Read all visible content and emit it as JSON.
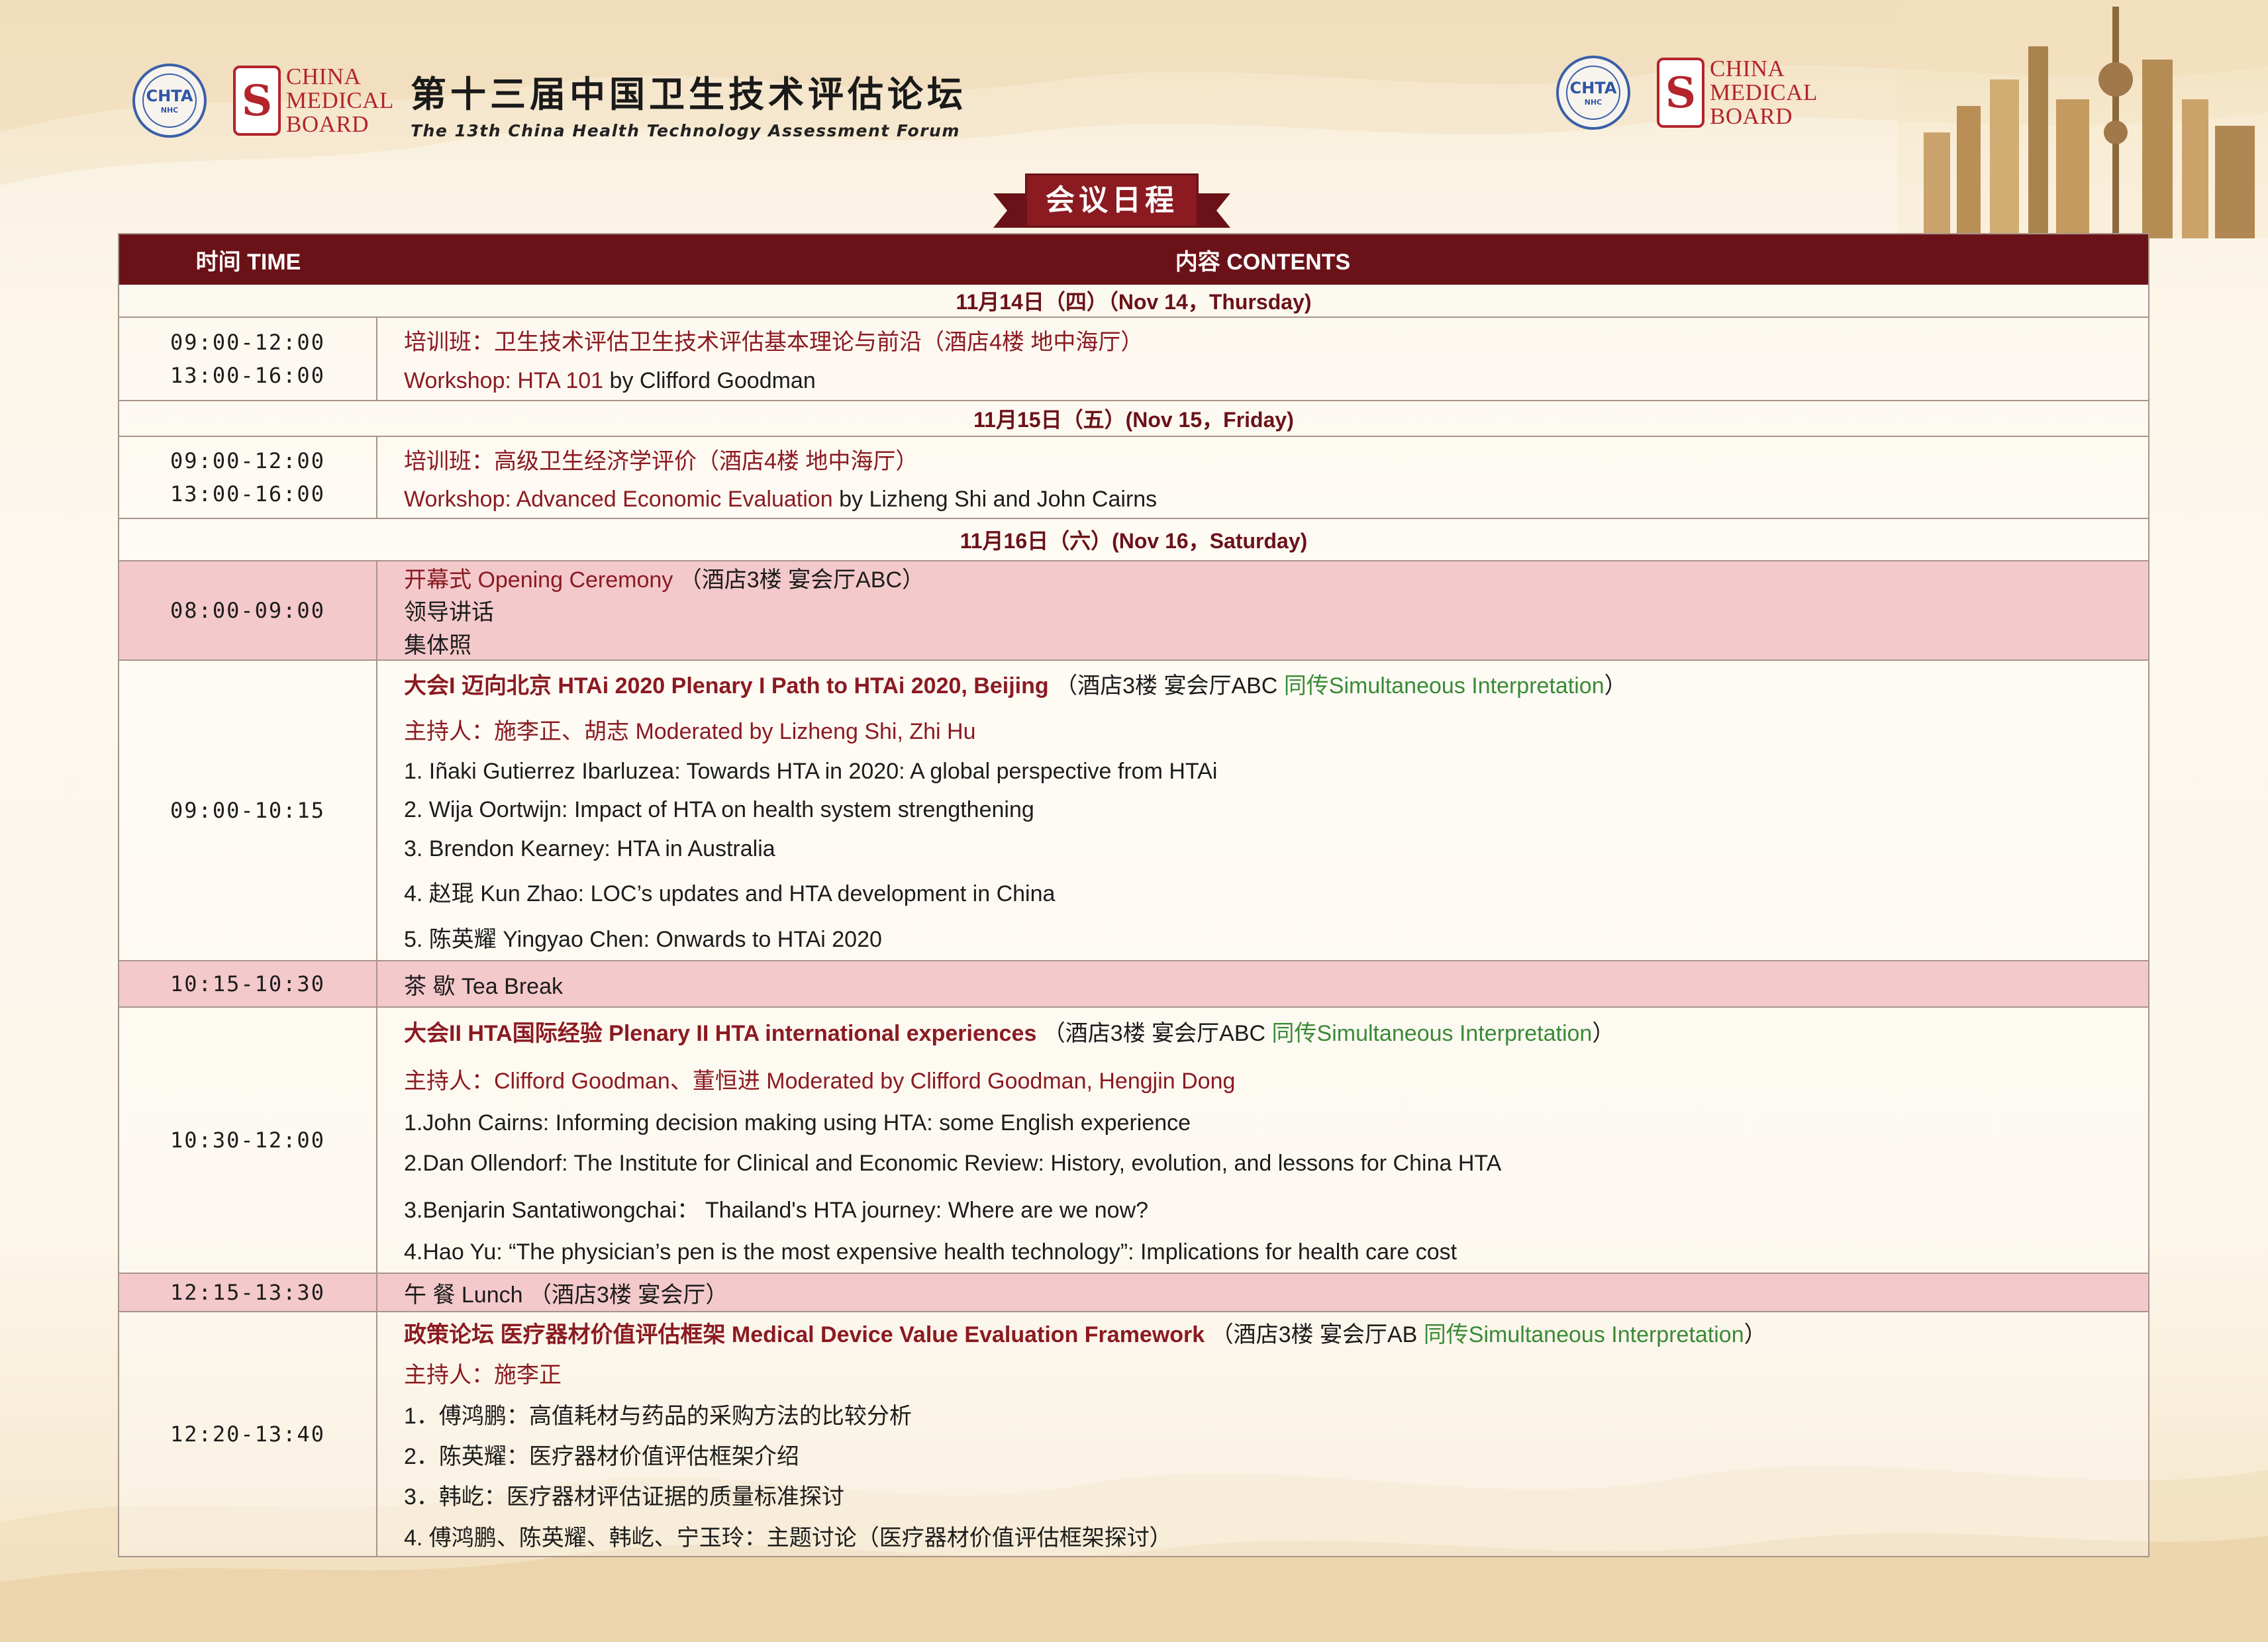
{
  "header": {
    "seal_text": "CHTA",
    "seal_sub": "NHC",
    "cmb_mark": "S",
    "cmb_name": [
      "CHINA",
      "MEDICAL",
      "BOARD"
    ],
    "title_cn": "第十三届中国卫生技术评估论坛",
    "title_en": "The 13th China Health Technology Assessment Forum",
    "colors": {
      "maroon": "#6b1218",
      "red": "#8b1a21",
      "green": "#3a8a36",
      "pink": "#f4c9cc",
      "seal_blue": "#3b5fa8"
    }
  },
  "banner": {
    "label": "会议日程"
  },
  "table": {
    "col_time": "时间  TIME",
    "col_contents": "内容  CONTENTS",
    "days": [
      {
        "label": "11月14日（四）（Nov 14，Thursday)",
        "rows": [
          {
            "times": [
              "09:00-12:00",
              "13:00-16:00"
            ],
            "lines": [
              {
                "parts": [
                  {
                    "t": "培训班：卫生技术评估卫生技术评估基本理论与前沿（酒店4楼  地中海厅）",
                    "s": "red"
                  }
                ]
              },
              {
                "parts": [
                  {
                    "t": "Workshop: HTA 101",
                    "s": "red"
                  },
                  {
                    "t": " by Clifford Goodman",
                    "s": ""
                  }
                ]
              }
            ]
          }
        ]
      },
      {
        "label": "11月15日（五）(Nov 15，Friday)",
        "rows": [
          {
            "times": [
              "09:00-12:00",
              "13:00-16:00"
            ],
            "lines": [
              {
                "parts": [
                  {
                    "t": "培训班：高级卫生经济学评价（酒店4楼  地中海厅）",
                    "s": "red"
                  }
                ]
              },
              {
                "parts": [
                  {
                    "t": "Workshop: Advanced Economic Evaluation",
                    "s": "red"
                  },
                  {
                    "t": " by Lizheng Shi and John Cairns",
                    "s": ""
                  }
                ]
              }
            ]
          }
        ]
      },
      {
        "label": "11月16日（六）(Nov 16，Saturday)",
        "rows": [
          {
            "pink": true,
            "times": [
              "08:00-09:00"
            ],
            "lines": [
              {
                "parts": [
                  {
                    "t": "开幕式  Opening Ceremony",
                    "s": "red"
                  },
                  {
                    "t": "  （酒店3楼  宴会厅ABC）",
                    "s": ""
                  }
                ]
              },
              {
                "parts": [
                  {
                    "t": "领导讲话",
                    "s": ""
                  }
                ]
              },
              {
                "parts": [
                  {
                    "t": "集体照",
                    "s": ""
                  }
                ]
              }
            ]
          },
          {
            "times": [
              "09:00-10:15"
            ],
            "lines": [
              {
                "parts": [
                  {
                    "t": "大会I 迈向北京 HTAi 2020  Plenary I Path to HTAi 2020, Beijing",
                    "s": "boldred"
                  },
                  {
                    "t": "  （酒店3楼  宴会厅ABC ",
                    "s": ""
                  },
                  {
                    "t": "同传Simultaneous Interpretation",
                    "s": "green"
                  },
                  {
                    "t": "）",
                    "s": ""
                  }
                ]
              },
              {
                "parts": [
                  {
                    "t": "主持人：施李正、胡志   Moderated by Lizheng Shi, Zhi Hu",
                    "s": "red"
                  }
                ]
              },
              {
                "parts": [
                  {
                    "t": "1. Iñaki Gutierrez Ibarluzea: Towards HTA in 2020: A global perspective from HTAi",
                    "s": ""
                  }
                ]
              },
              {
                "parts": [
                  {
                    "t": "2. Wija Oortwijn: Impact of HTA on health system strengthening",
                    "s": ""
                  }
                ]
              },
              {
                "parts": [
                  {
                    "t": "3. Brendon Kearney: HTA in Australia",
                    "s": ""
                  }
                ]
              },
              {
                "parts": [
                  {
                    "t": "4. 赵琨  Kun Zhao: LOC’s updates and HTA development in China",
                    "s": ""
                  }
                ]
              },
              {
                "parts": [
                  {
                    "t": "5. 陈英耀  Yingyao Chen: Onwards to HTAi 2020",
                    "s": ""
                  }
                ]
              }
            ]
          },
          {
            "pink": true,
            "times": [
              "10:15-10:30"
            ],
            "lines": [
              {
                "parts": [
                  {
                    "t": "茶  歇    Tea Break",
                    "s": ""
                  }
                ]
              }
            ]
          },
          {
            "times": [
              "10:30-12:00"
            ],
            "lines": [
              {
                "parts": [
                  {
                    "t": "大会II HTA国际经验 Plenary II HTA international experiences",
                    "s": "boldred"
                  },
                  {
                    "t": "  （酒店3楼  宴会厅ABC ",
                    "s": ""
                  },
                  {
                    "t": "同传Simultaneous Interpretation",
                    "s": "green"
                  },
                  {
                    "t": "）",
                    "s": ""
                  }
                ]
              },
              {
                "parts": [
                  {
                    "t": "主持人：Clifford Goodman、董恒进   Moderated by Clifford Goodman, Hengjin Dong",
                    "s": "red"
                  }
                ]
              },
              {
                "parts": [
                  {
                    "t": "1.John Cairns: Informing decision making using HTA: some English experience",
                    "s": ""
                  }
                ]
              },
              {
                "parts": [
                  {
                    "t": "2.Dan Ollendorf: The Institute for Clinical and Economic Review: History, evolution, and lessons for China HTA",
                    "s": ""
                  }
                ]
              },
              {
                "parts": [
                  {
                    "t": "3.Benjarin Santatiwongchai：  Thailand's HTA journey: Where are we now?",
                    "s": ""
                  }
                ]
              },
              {
                "parts": [
                  {
                    "t": "4.Hao Yu: “The physician’s pen is the most expensive health technology”: Implications for health care cost",
                    "s": ""
                  }
                ]
              }
            ]
          },
          {
            "pink": true,
            "times": [
              "12:15-13:30"
            ],
            "lines": [
              {
                "parts": [
                  {
                    "t": "午  餐    Lunch  （酒店3楼  宴会厅）",
                    "s": ""
                  }
                ]
              }
            ]
          },
          {
            "times": [
              "12:20-13:40"
            ],
            "lines": [
              {
                "parts": [
                  {
                    "t": "政策论坛 医疗器材价值评估框架  Medical Device Value Evaluation Framework",
                    "s": "boldred"
                  },
                  {
                    "t": "  （酒店3楼  宴会厅AB   ",
                    "s": ""
                  },
                  {
                    "t": "同传Simultaneous Interpretation",
                    "s": "green"
                  },
                  {
                    "t": "）",
                    "s": ""
                  }
                ]
              },
              {
                "parts": [
                  {
                    "t": "主持人：施李正",
                    "s": "red"
                  }
                ]
              },
              {
                "parts": [
                  {
                    "t": "1．傅鸿鹏：高值耗材与药品的采购方法的比较分析",
                    "s": ""
                  }
                ]
              },
              {
                "parts": [
                  {
                    "t": "2．陈英耀：医疗器材价值评估框架介绍",
                    "s": ""
                  }
                ]
              },
              {
                "parts": [
                  {
                    "t": "3．韩屹：医疗器材评估证据的质量标准探讨",
                    "s": ""
                  }
                ]
              },
              {
                "parts": [
                  {
                    "t": "4.  傅鸿鹏、陈英耀、韩屹、宁玉玲：主题讨论（医疗器材价值评估框架探讨）",
                    "s": ""
                  }
                ]
              }
            ]
          }
        ]
      }
    ]
  }
}
